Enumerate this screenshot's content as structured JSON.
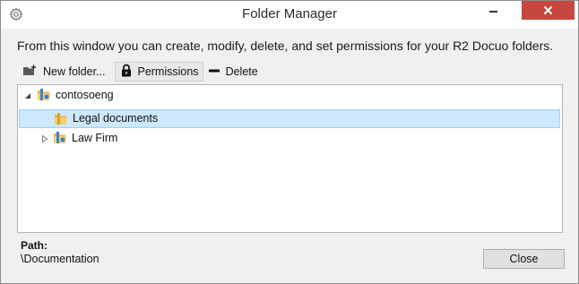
{
  "window": {
    "title": "Folder Manager",
    "close_glyph": "✕",
    "accent_close_color": "#c7463e"
  },
  "description": "From this window you can create, modify, delete, and set permissions for your R2 Docuo folders.",
  "toolbar": {
    "new_folder_label": "New folder...",
    "permissions_label": "Permissions",
    "delete_label": "Delete",
    "icons": [
      "new-folder-icon",
      "lock-icon",
      "minus-icon"
    ]
  },
  "tree": {
    "selection_color": "#cde8ff",
    "items": [
      {
        "label": "contosoeng",
        "expanded": true,
        "icon": "shared-folder-icon"
      },
      {
        "label": "Legal documents",
        "selected": true,
        "icon": "folder-icon"
      },
      {
        "label": "Law Firm",
        "expanded": false,
        "icon": "shared-folder-icon"
      }
    ]
  },
  "footer": {
    "path_label": "Path:",
    "path_value": "\\Documentation",
    "close_button_label": "Close"
  }
}
